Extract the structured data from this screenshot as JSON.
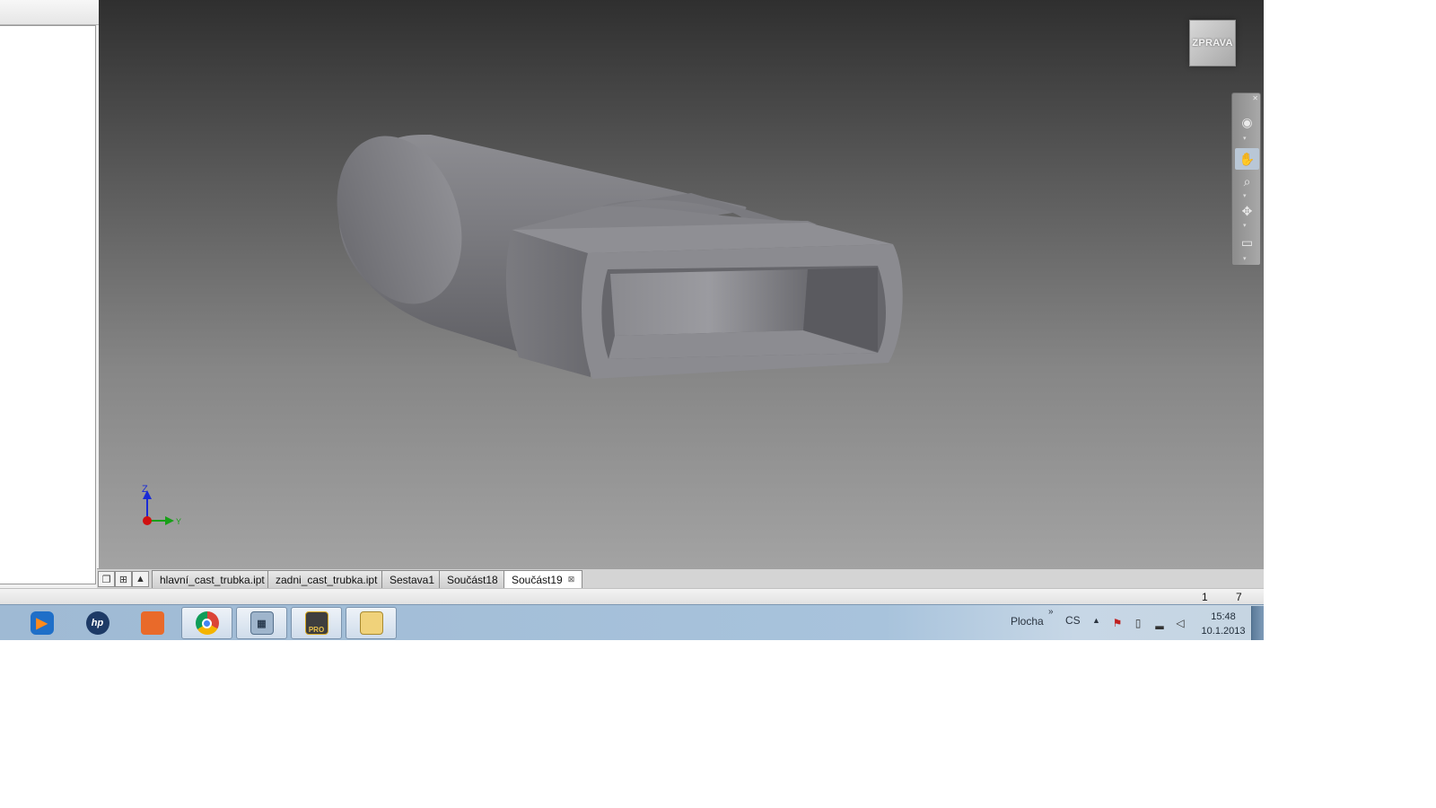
{
  "viewport": {
    "view_cube_label": "ZPRAVA",
    "axis_labels": {
      "z": "Z",
      "y": "Y"
    },
    "navigation_bar": {
      "buttons": [
        {
          "icon": "steering-wheel-icon"
        },
        {
          "icon": "pan-hand-icon",
          "active": true
        },
        {
          "icon": "zoom-icon"
        },
        {
          "icon": "orbit-icon"
        },
        {
          "icon": "view-face-icon"
        }
      ]
    }
  },
  "document_tabs": {
    "tabs": [
      {
        "label": "hlavní_cast_trubka.ipt"
      },
      {
        "label": "zadni_cast_trubka.ipt"
      },
      {
        "label": "Sestava1"
      },
      {
        "label": "Součást18"
      },
      {
        "label": "Součást19",
        "active": true
      }
    ]
  },
  "status_bar": {
    "value_1": "1",
    "value_2": "7"
  },
  "taskbar": {
    "tray": {
      "plocha_label": "Plocha",
      "language": "CS",
      "time": "15:48",
      "date": "10.1.2013"
    },
    "buttons": [
      {
        "icon": "folder-icon"
      },
      {
        "icon": "media-player-icon"
      },
      {
        "icon": "hp-icon"
      },
      {
        "icon": "paint-icon"
      },
      {
        "icon": "chrome-icon"
      },
      {
        "icon": "calculator-icon"
      },
      {
        "icon": "inventor-pro-icon",
        "badge": "PRO"
      },
      {
        "icon": "email-icon"
      }
    ]
  }
}
